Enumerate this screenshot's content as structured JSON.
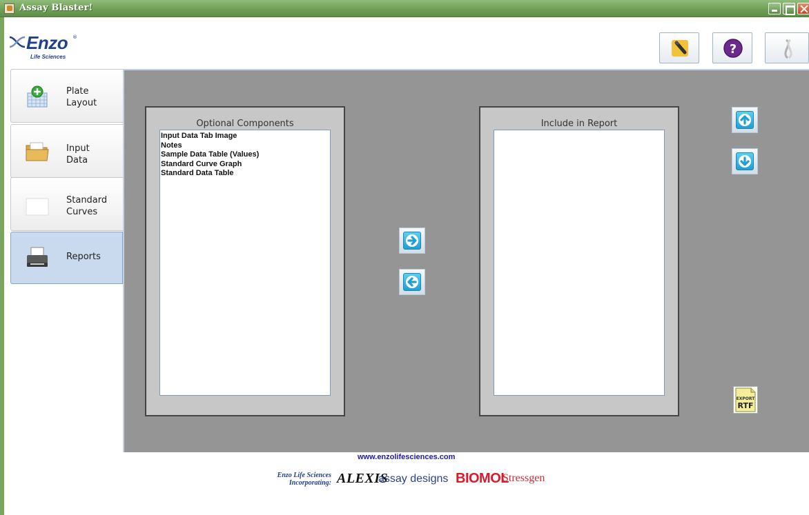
{
  "window": {
    "title": "Assay Blaster!"
  },
  "logo": {
    "word": "Enzo",
    "registered": "®",
    "subtitle": "Life Sciences"
  },
  "header_buttons": [
    {
      "name": "brush-icon",
      "label": ""
    },
    {
      "name": "help-icon",
      "label": "?"
    },
    {
      "name": "enzo-helix-icon",
      "label": ""
    }
  ],
  "nav": {
    "tabs": [
      {
        "label": "Plate Layout",
        "line1": "Plate",
        "line2": "Layout",
        "icon": "plate-add-icon",
        "selected": false
      },
      {
        "label": "Input Data",
        "line1": "Input",
        "line2": "Data",
        "icon": "folder-icon",
        "selected": false
      },
      {
        "label": "Standard Curves",
        "line1": "Standard",
        "line2": "Curves",
        "icon": "blank-graph-icon",
        "selected": false
      },
      {
        "label": "Reports",
        "line1": "Reports",
        "line2": "",
        "icon": "printer-icon",
        "selected": true
      }
    ]
  },
  "optional": {
    "title": "Optional Components",
    "items": [
      "Input Data Tab Image",
      "Notes",
      "Sample Data Table (Values)",
      "Standard Curve Graph",
      "Standard Data Table"
    ]
  },
  "include": {
    "title": "Include in Report",
    "items": []
  },
  "buttons": {
    "move_right": "arrow-right-icon",
    "move_left": "arrow-left-icon",
    "move_up": "arrow-up-icon",
    "move_down": "arrow-down-icon",
    "export_top": "EXPORT",
    "export_bottom": "RTF"
  },
  "footer": {
    "url": "www.enzolifesciences.com",
    "incorporating_line1": "Enzo Life Sciences",
    "incorporating_line2": "Incorporating:",
    "brands": [
      "ALEXIS",
      "assay designs",
      "BIOMOL",
      "Stressgen"
    ]
  },
  "colors": {
    "titlebar": "#6e9e55",
    "work_area": "#959595",
    "selected_tab": "#c9d9ee",
    "arrow_button": "#1f9fd3",
    "brand_blue": "#1f3f8f",
    "brand_red": "#e0192a"
  }
}
